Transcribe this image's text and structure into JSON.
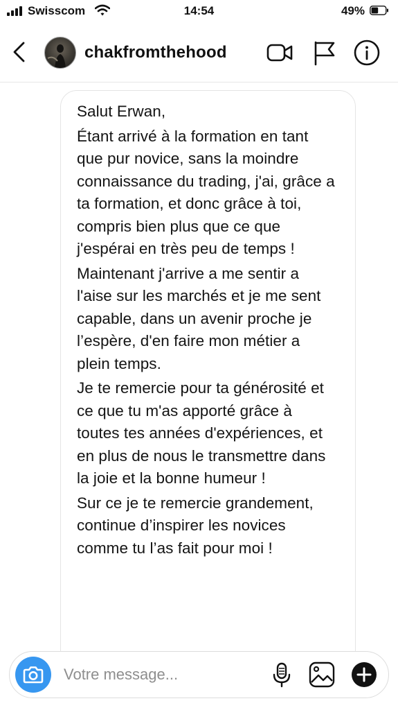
{
  "status_bar": {
    "carrier": "Swisscom",
    "time": "14:54",
    "battery_percent": "49%",
    "battery_level": 0.49
  },
  "header": {
    "username": "chakfromthehood",
    "icons": [
      "back-arrow-icon",
      "avatar",
      "video-camera-icon",
      "flag-icon",
      "info-icon"
    ]
  },
  "message": {
    "paragraphs": [
      "Salut Erwan,",
      "Étant arrivé à la formation en tant que pur novice, sans la moindre connaissance du trading, j'ai, grâce a ta formation, et donc grâce à toi, compris bien plus que ce que j'espérai en très peu de temps !",
      "Maintenant j'arrive a me sentir a l'aise sur les marchés et je me sent capable, dans un avenir proche je l’espère, d'en faire mon métier a plein temps.",
      "Je te remercie pour ta générosité et ce que tu m'as apporté grâce à toutes tes années d'expériences, et en plus de nous le transmettre dans la joie et la bonne humeur !",
      "Sur ce je te remercie grandement, continue d’inspirer les novices comme tu l’as fait pour moi !"
    ]
  },
  "composer": {
    "placeholder": "Votre message...",
    "icons": [
      "camera-icon",
      "microphone-icon",
      "gallery-icon",
      "plus-icon"
    ]
  },
  "colors": {
    "accent": "#3797f0",
    "text": "#141414",
    "placeholder": "#8e8e8e",
    "border": "#e4e4e4"
  }
}
